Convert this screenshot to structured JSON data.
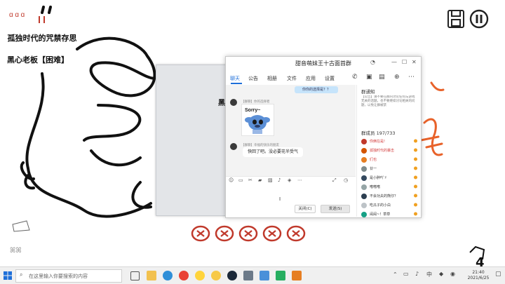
{
  "game": {
    "title": "孤独时代的咒禁存思",
    "difficulty_label": "黑心老板【困难】",
    "paper_title": "黑",
    "corner_number": "4"
  },
  "qq_window": {
    "title": "甜音萌妹王十古面首群",
    "tabs": [
      "聊天",
      "公告",
      "相册",
      "文件",
      "应用",
      "设置"
    ],
    "active_tab": "聊天",
    "chat": {
      "top_bubble": "你你的选择是？？",
      "message1_nick": "【群聊】你的选择者",
      "sticker_label": "Sorry~",
      "message2_nick": "【群聊】幸福的快乐的朋友",
      "message2_text": "快回了吧。没必要花半受气"
    },
    "buttons": {
      "close": "关闭(C)",
      "send": "发送(S)"
    }
  },
  "sidebar": {
    "notice_title": "群通知",
    "notice_body": "【公告】请不要在群内讨论任何与游戏无关的话题。也不要继续讨论相关的问题，以免让群被禁",
    "members_header": "群成员 197/733",
    "members": [
      {
        "name": "你俩在是!",
        "highlight": true
      },
      {
        "name": "孤独时代的暴击",
        "highlight": true
      },
      {
        "name": "们也",
        "highlight": true
      },
      {
        "name": "廿一",
        "highlight": false
      },
      {
        "name": "是小胖吖ゞ",
        "highlight": false
      },
      {
        "name": "嗜嗜嗜",
        "highlight": false
      },
      {
        "name": "不会功夫的熊仔？",
        "highlight": false
      },
      {
        "name": "吃瓜子的小白",
        "highlight": false
      },
      {
        "name": "闹闹~！草草",
        "highlight": false
      }
    ]
  },
  "taskbar": {
    "search_placeholder": "在这里输入你要搜索的内容",
    "time": "21:40",
    "date": "2021/6/25"
  },
  "colors": {
    "accent_blue": "#1e6fd9",
    "member_red": "#d23b3b",
    "scribble_orange": "#e8622a",
    "stamp_red": "#c0392b"
  }
}
